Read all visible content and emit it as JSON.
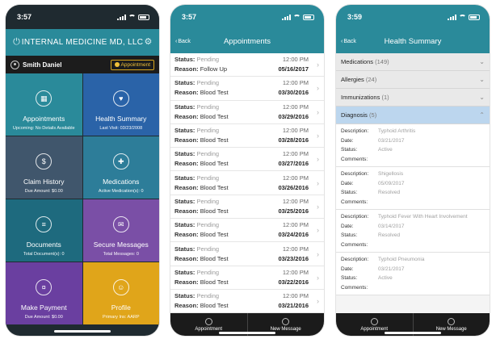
{
  "phone1": {
    "time": "3:57",
    "title": "INTERNAL MEDICINE MD, LLC",
    "user": "Smith Daniel",
    "appointment_button": "Appointment",
    "tiles": [
      {
        "label": "Appointments",
        "sub": "Upcoming: No Details Available",
        "icon": "calendar-icon"
      },
      {
        "label": "Health Summary",
        "sub": "Last Visit: 03/23/2008",
        "icon": "heart-icon"
      },
      {
        "label": "Claim History",
        "sub": "Due Amount: $0.00",
        "icon": "dollar-icon"
      },
      {
        "label": "Medications",
        "sub": "Active Medication(s): 0",
        "icon": "pill-icon"
      },
      {
        "label": "Documents",
        "sub": "Total Document(s): 0",
        "icon": "document-icon"
      },
      {
        "label": "Secure Messages",
        "sub": "Total Messages: 0",
        "icon": "envelope-icon"
      },
      {
        "label": "Make Payment",
        "sub": "Due Amount: $0.00",
        "icon": "payment-icon"
      },
      {
        "label": "Profile",
        "sub": "Primary Ins: AARP",
        "icon": "profile-icon"
      }
    ]
  },
  "phone2": {
    "time": "3:57",
    "back": "Back",
    "title": "Appointments",
    "status_key": "Status:",
    "reason_key": "Reason:",
    "rows": [
      {
        "status": "Pending",
        "reason": "Follow Up",
        "time": "12:00 PM",
        "date": "05/16/2017"
      },
      {
        "status": "Pending",
        "reason": "Blood Test",
        "time": "12:00 PM",
        "date": "03/30/2016"
      },
      {
        "status": "Pending",
        "reason": "Blood Test",
        "time": "12:00 PM",
        "date": "03/29/2016"
      },
      {
        "status": "Pending",
        "reason": "Blood Test",
        "time": "12:00 PM",
        "date": "03/28/2016"
      },
      {
        "status": "Pending",
        "reason": "Blood Test",
        "time": "12:00 PM",
        "date": "03/27/2016"
      },
      {
        "status": "Pending",
        "reason": "Blood Test",
        "time": "12:00 PM",
        "date": "03/26/2016"
      },
      {
        "status": "Pending",
        "reason": "Blood Test",
        "time": "12:00 PM",
        "date": "03/25/2016"
      },
      {
        "status": "Pending",
        "reason": "Blood Test",
        "time": "12:00 PM",
        "date": "03/24/2016"
      },
      {
        "status": "Pending",
        "reason": "Blood Test",
        "time": "12:00 PM",
        "date": "03/23/2016"
      },
      {
        "status": "Pending",
        "reason": "Blood Test",
        "time": "12:00 PM",
        "date": "03/22/2016"
      },
      {
        "status": "Pending",
        "reason": "Blood Test",
        "time": "12:00 PM",
        "date": "03/21/2016"
      }
    ],
    "bottom": {
      "appointment": "Appointment",
      "new_message": "New Message"
    }
  },
  "phone3": {
    "time": "3:59",
    "back": "Back",
    "title": "Health Summary",
    "sections": [
      {
        "name": "Medications",
        "count": "(149)"
      },
      {
        "name": "Allergies",
        "count": "(24)"
      },
      {
        "name": "Immunizations",
        "count": "(1)"
      },
      {
        "name": "Diagnosis",
        "count": "(5)"
      }
    ],
    "labels": {
      "description": "Description:",
      "date": "Date:",
      "status": "Status:",
      "comments": "Comments:"
    },
    "diagnoses": [
      {
        "description": "Typhoid Arthritis",
        "date": "03/21/2017",
        "status": "Active",
        "comments": ""
      },
      {
        "description": "Shigellosis",
        "date": "05/09/2017",
        "status": "Resolved",
        "comments": ""
      },
      {
        "description": "Typhoid Fever With Heart Involvement",
        "date": "03/14/2017",
        "status": "Resolved",
        "comments": ""
      },
      {
        "description": "Typhoid Pneumonia",
        "date": "03/21/2017",
        "status": "Active",
        "comments": ""
      }
    ],
    "bottom": {
      "appointment": "Appointment",
      "new_message": "New Message"
    }
  }
}
